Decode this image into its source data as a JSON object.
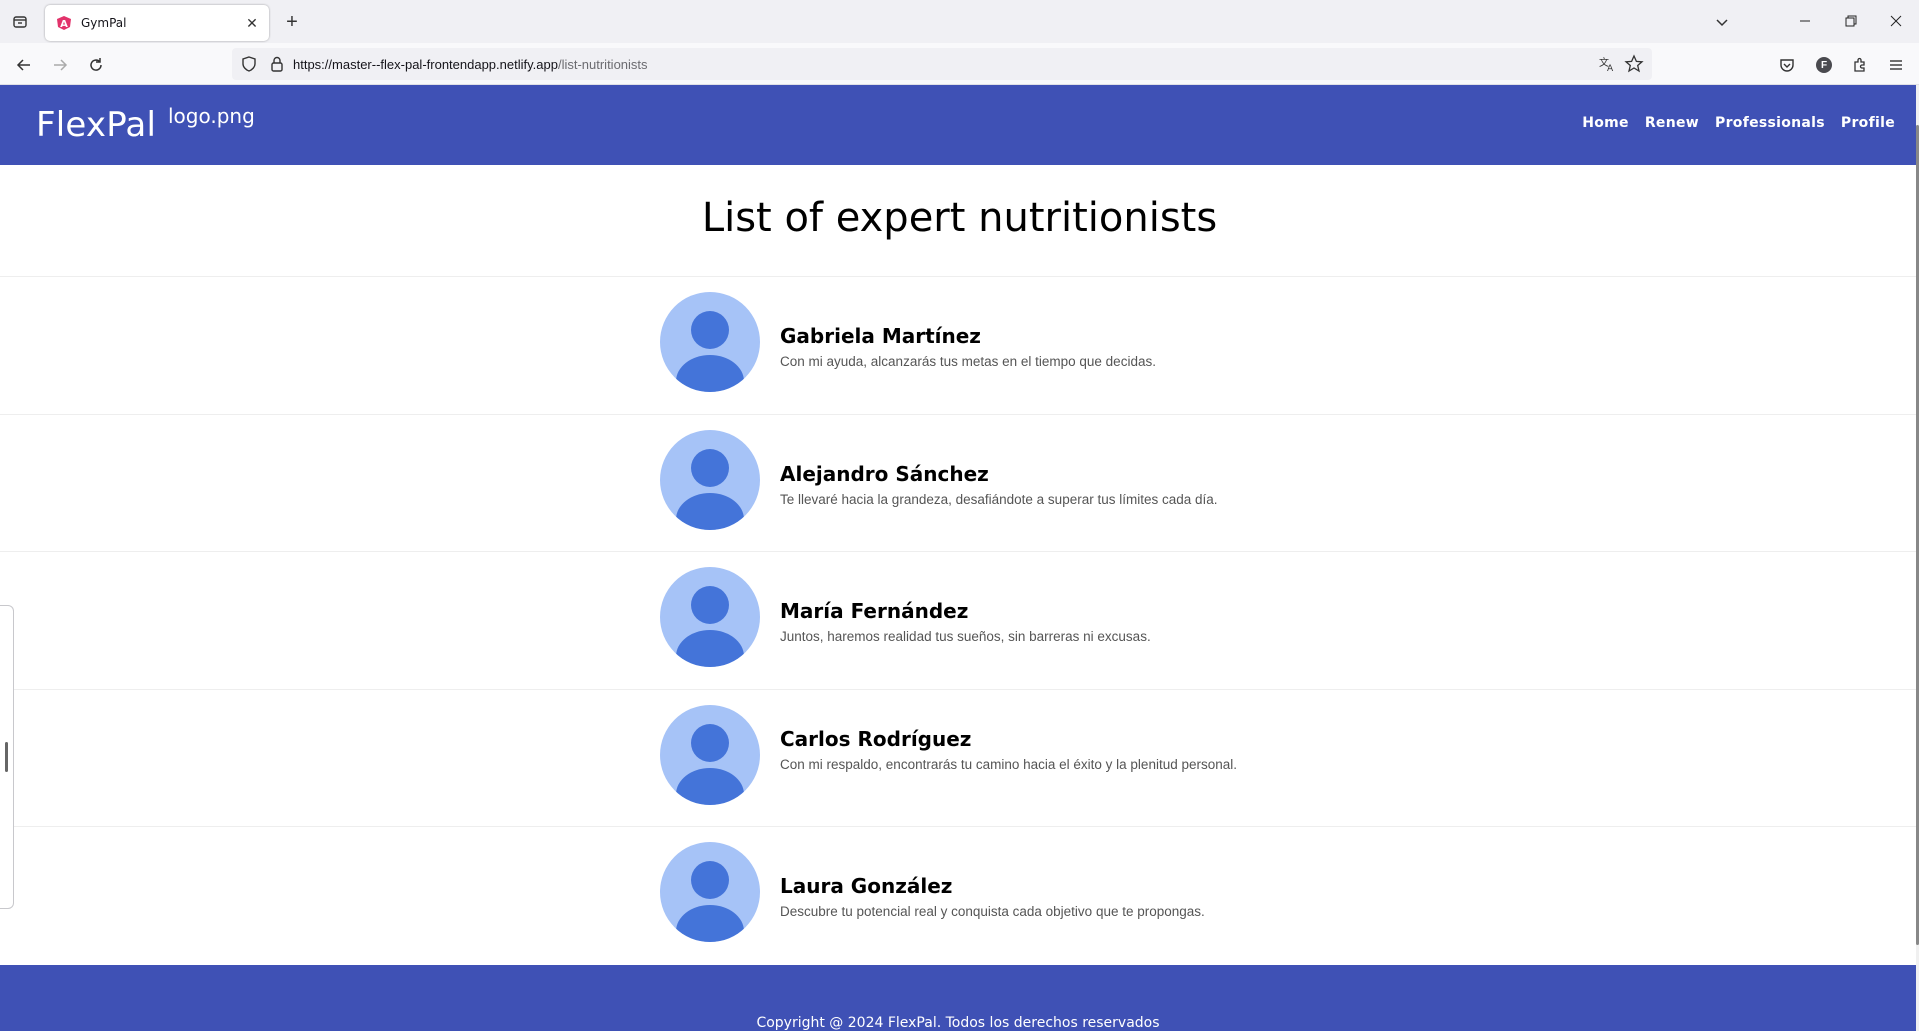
{
  "browser": {
    "tab_title": "GymPal",
    "url_host": "https://master--flex-pal-frontendapp.netlify.app",
    "url_path": "/list-nutritionists",
    "account_initial": "F"
  },
  "header": {
    "brand": "FlexPal",
    "logo_alt": "logo.png",
    "menu": [
      "Home",
      "Renew",
      "Professionals",
      "Profile"
    ]
  },
  "main": {
    "title": "List of expert nutritionists",
    "nutritionists": [
      {
        "name": "Gabriela Martínez",
        "description": "Con mi ayuda, alcanzarás tus metas en el tiempo que decidas."
      },
      {
        "name": "Alejandro Sánchez",
        "description": "Te llevaré hacia la grandeza, desafiándote a superar tus límites cada día."
      },
      {
        "name": "María Fernández",
        "description": "Juntos, haremos realidad tus sueños, sin barreras ni excusas."
      },
      {
        "name": "Carlos Rodríguez",
        "description": "Con mi respaldo, encontrarás tu camino hacia el éxito y la plenitud personal."
      },
      {
        "name": "Laura González",
        "description": "Descubre tu potencial real y conquista cada objetivo que te propongas."
      }
    ]
  },
  "footer": {
    "copyright": "Copyright @ 2024 FlexPal. Todos los derechos reservados"
  },
  "colors": {
    "primary": "#3f51b5",
    "avatar_bg": "#a6c3f7",
    "avatar_fg": "#4474d9"
  }
}
